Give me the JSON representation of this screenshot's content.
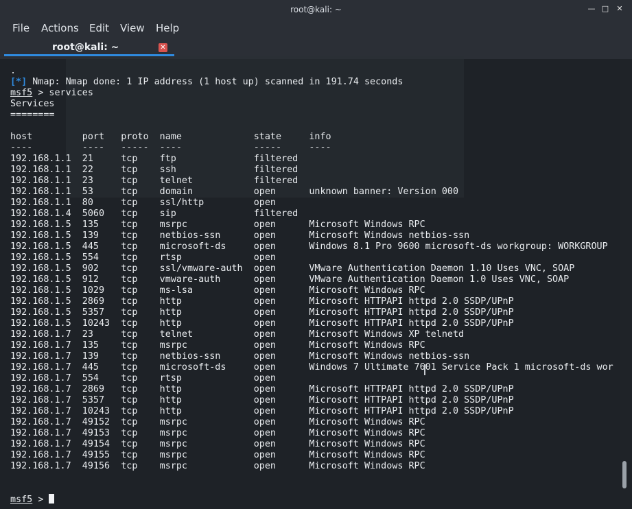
{
  "window": {
    "title": "root@kali: ~",
    "controls": {
      "minimize": "minimize-icon",
      "maximize": "maximize-icon",
      "close": "close-icon"
    }
  },
  "menubar": {
    "items": [
      "File",
      "Actions",
      "Edit",
      "View",
      "Help"
    ]
  },
  "tab": {
    "label": "root@kali: ~",
    "close_icon": "close-icon",
    "accent_color": "#2f8be0"
  },
  "terminal": {
    "dot_line": ".",
    "nmap_prefix": "[*]",
    "nmap_message": "Nmap: Nmap done: 1 IP address (1 host up) scanned in 191.74 seconds",
    "prompt": "msf5",
    "command": "> services",
    "section_title": "Services",
    "section_underline": "========",
    "headers": [
      "host",
      "port",
      "proto",
      "name",
      "state",
      "info"
    ],
    "header_underlines": [
      "----",
      "----",
      "-----",
      "----",
      "-----",
      "----"
    ],
    "rows": [
      [
        "192.168.1.1",
        "21",
        "tcp",
        "ftp",
        "filtered",
        ""
      ],
      [
        "192.168.1.1",
        "22",
        "tcp",
        "ssh",
        "filtered",
        ""
      ],
      [
        "192.168.1.1",
        "23",
        "tcp",
        "telnet",
        "filtered",
        ""
      ],
      [
        "192.168.1.1",
        "53",
        "tcp",
        "domain",
        "open",
        "unknown banner: Version 000"
      ],
      [
        "192.168.1.1",
        "80",
        "tcp",
        "ssl/http",
        "open",
        ""
      ],
      [
        "192.168.1.4",
        "5060",
        "tcp",
        "sip",
        "filtered",
        ""
      ],
      [
        "192.168.1.5",
        "135",
        "tcp",
        "msrpc",
        "open",
        "Microsoft Windows RPC"
      ],
      [
        "192.168.1.5",
        "139",
        "tcp",
        "netbios-ssn",
        "open",
        "Microsoft Windows netbios-ssn"
      ],
      [
        "192.168.1.5",
        "445",
        "tcp",
        "microsoft-ds",
        "open",
        "Windows 8.1 Pro 9600 microsoft-ds workgroup: WORKGROUP"
      ],
      [
        "192.168.1.5",
        "554",
        "tcp",
        "rtsp",
        "open",
        ""
      ],
      [
        "192.168.1.5",
        "902",
        "tcp",
        "ssl/vmware-auth",
        "open",
        "VMware Authentication Daemon 1.10 Uses VNC, SOAP"
      ],
      [
        "192.168.1.5",
        "912",
        "tcp",
        "vmware-auth",
        "open",
        "VMware Authentication Daemon 1.0 Uses VNC, SOAP"
      ],
      [
        "192.168.1.5",
        "1029",
        "tcp",
        "ms-lsa",
        "open",
        "Microsoft Windows RPC"
      ],
      [
        "192.168.1.5",
        "2869",
        "tcp",
        "http",
        "open",
        "Microsoft HTTPAPI httpd 2.0 SSDP/UPnP"
      ],
      [
        "192.168.1.5",
        "5357",
        "tcp",
        "http",
        "open",
        "Microsoft HTTPAPI httpd 2.0 SSDP/UPnP"
      ],
      [
        "192.168.1.5",
        "10243",
        "tcp",
        "http",
        "open",
        "Microsoft HTTPAPI httpd 2.0 SSDP/UPnP"
      ],
      [
        "192.168.1.7",
        "23",
        "tcp",
        "telnet",
        "open",
        "Microsoft Windows XP telnetd"
      ],
      [
        "192.168.1.7",
        "135",
        "tcp",
        "msrpc",
        "open",
        "Microsoft Windows RPC"
      ],
      [
        "192.168.1.7",
        "139",
        "tcp",
        "netbios-ssn",
        "open",
        "Microsoft Windows netbios-ssn"
      ],
      [
        "192.168.1.7",
        "445",
        "tcp",
        "microsoft-ds",
        "open",
        "Windows 7 Ultimate 7601 Service Pack 1 microsoft-ds wor"
      ],
      [
        "192.168.1.7",
        "554",
        "tcp",
        "rtsp",
        "open",
        ""
      ],
      [
        "192.168.1.7",
        "2869",
        "tcp",
        "http",
        "open",
        "Microsoft HTTPAPI httpd 2.0 SSDP/UPnP"
      ],
      [
        "192.168.1.7",
        "5357",
        "tcp",
        "http",
        "open",
        "Microsoft HTTPAPI httpd 2.0 SSDP/UPnP"
      ],
      [
        "192.168.1.7",
        "10243",
        "tcp",
        "http",
        "open",
        "Microsoft HTTPAPI httpd 2.0 SSDP/UPnP"
      ],
      [
        "192.168.1.7",
        "49152",
        "tcp",
        "msrpc",
        "open",
        "Microsoft Windows RPC"
      ],
      [
        "192.168.1.7",
        "49153",
        "tcp",
        "msrpc",
        "open",
        "Microsoft Windows RPC"
      ],
      [
        "192.168.1.7",
        "49154",
        "tcp",
        "msrpc",
        "open",
        "Microsoft Windows RPC"
      ],
      [
        "192.168.1.7",
        "49155",
        "tcp",
        "msrpc",
        "open",
        "Microsoft Windows RPC"
      ],
      [
        "192.168.1.7",
        "49156",
        "tcp",
        "msrpc",
        "open",
        "Microsoft Windows RPC"
      ]
    ],
    "final_prompt": "msf5",
    "final_prompt_suffix": ">"
  }
}
